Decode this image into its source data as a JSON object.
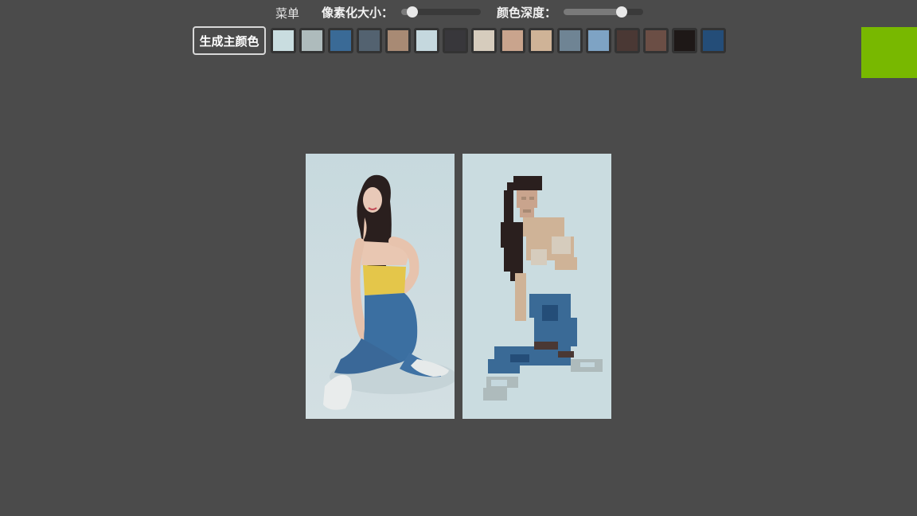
{
  "toolbar": {
    "menu_label": "菜单",
    "pixel_size_label": "像素化大小：",
    "pixel_size_value": 0.14,
    "color_depth_label": "颜色深度：",
    "color_depth_value": 0.73,
    "generate_button_label": "生成主颜色"
  },
  "palette": [
    "#c9dde0",
    "#aebbbc",
    "#3a6a96",
    "#536270",
    "#a88a74",
    "#c5d8de",
    "#38373b",
    "#d6ccbd",
    "#c9a48d",
    "#cfb397",
    "#6f8494",
    "#7ea3c4",
    "#4a3834",
    "#6b4e45",
    "#1e1817",
    "#244d78"
  ],
  "accent_color": "#78b800",
  "images": {
    "original": "photo-original",
    "pixelated": "photo-pixelated"
  }
}
